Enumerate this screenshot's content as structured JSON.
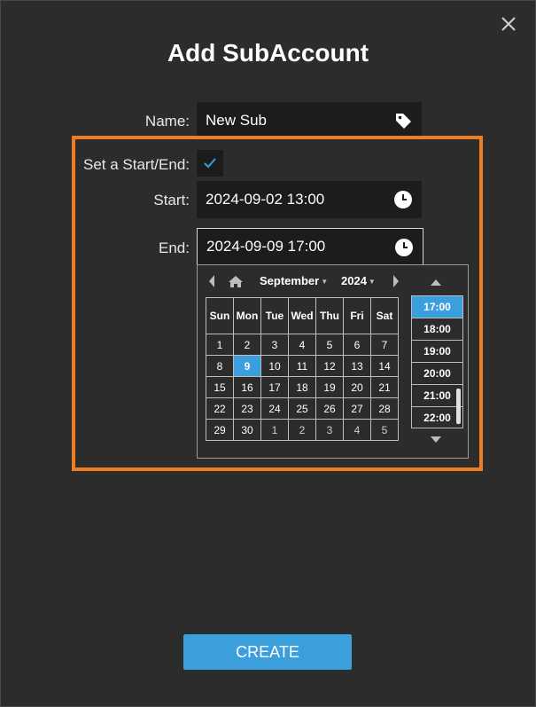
{
  "dialog": {
    "title": "Add SubAccount",
    "close_icon": "close-icon"
  },
  "form": {
    "name_label": "Name:",
    "name_value": "New Sub",
    "name_icon": "tag-icon",
    "toggle_label": "Set a Start/End:",
    "toggle_checked": true,
    "start_label": "Start:",
    "start_value": "2024-09-02 13:00",
    "end_label": "End:",
    "end_value": "2024-09-09 17:00",
    "clock_icon": "clock-icon"
  },
  "calendar": {
    "month": "September",
    "year": "2024",
    "weekdays": [
      "Sun",
      "Mon",
      "Tue",
      "Wed",
      "Thu",
      "Fri",
      "Sat"
    ],
    "weeks": [
      [
        "1",
        "2",
        "3",
        "4",
        "5",
        "6",
        "7"
      ],
      [
        "8",
        "9",
        "10",
        "11",
        "12",
        "13",
        "14"
      ],
      [
        "15",
        "16",
        "17",
        "18",
        "19",
        "20",
        "21"
      ],
      [
        "22",
        "23",
        "24",
        "25",
        "26",
        "27",
        "28"
      ],
      [
        "29",
        "30",
        "1",
        "2",
        "3",
        "4",
        "5"
      ]
    ],
    "selected_day": "9",
    "times": [
      "17:00",
      "18:00",
      "19:00",
      "20:00",
      "21:00",
      "22:00"
    ],
    "selected_time": "17:00"
  },
  "actions": {
    "create_label": "CREATE"
  },
  "colors": {
    "accent": "#3c9fdd",
    "highlight": "#f07d1f",
    "background": "#2c2c2c",
    "field": "#1c1c1c"
  }
}
